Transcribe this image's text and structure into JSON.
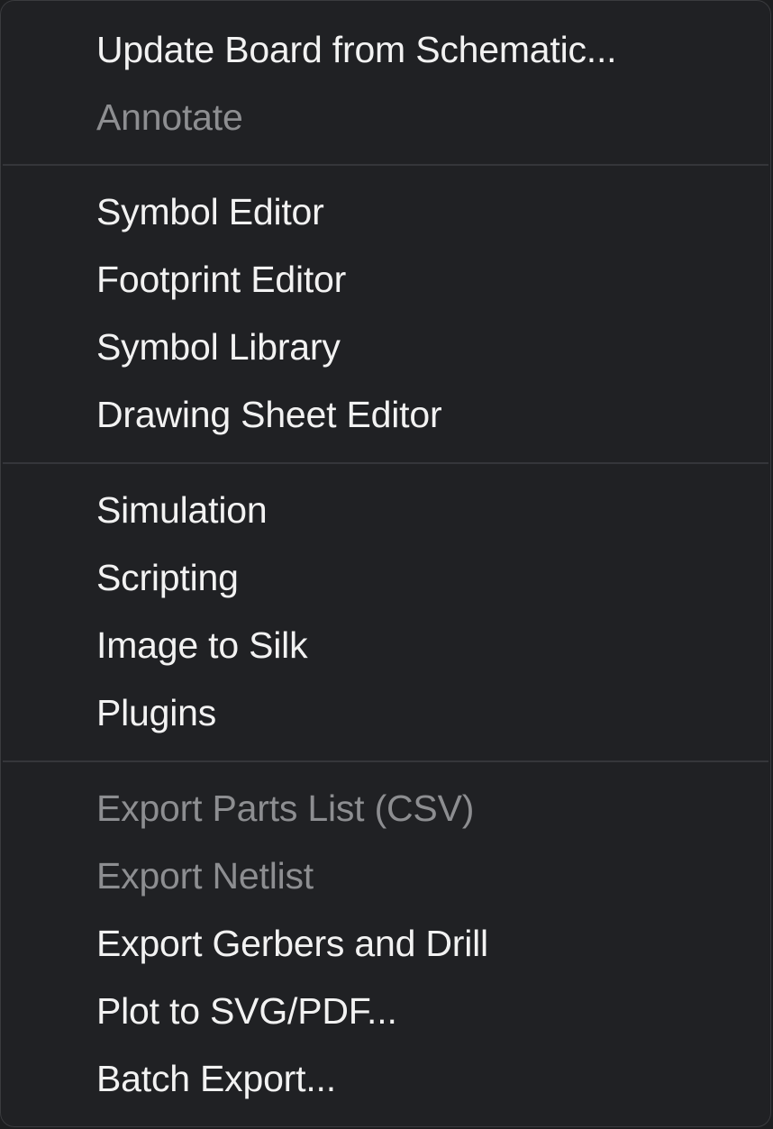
{
  "menu": {
    "groups": [
      {
        "items": [
          {
            "label": "Update Board from Schematic...",
            "enabled": true
          },
          {
            "label": "Annotate",
            "enabled": false
          }
        ]
      },
      {
        "items": [
          {
            "label": "Symbol Editor",
            "enabled": true
          },
          {
            "label": "Footprint Editor",
            "enabled": true
          },
          {
            "label": "Symbol Library",
            "enabled": true
          },
          {
            "label": "Drawing Sheet Editor",
            "enabled": true
          }
        ]
      },
      {
        "items": [
          {
            "label": "Simulation",
            "enabled": true
          },
          {
            "label": "Scripting",
            "enabled": true
          },
          {
            "label": "Image to Silk",
            "enabled": true
          },
          {
            "label": "Plugins",
            "enabled": true
          }
        ]
      },
      {
        "items": [
          {
            "label": "Export Parts List (CSV)",
            "enabled": false
          },
          {
            "label": "Export Netlist",
            "enabled": false
          },
          {
            "label": "Export Gerbers and Drill",
            "enabled": true
          },
          {
            "label": "Plot to SVG/PDF...",
            "enabled": true
          },
          {
            "label": "Batch Export...",
            "enabled": true
          }
        ]
      }
    ],
    "colors": {
      "background": "#202124",
      "text": "#f2f2f2",
      "disabled_text": "#8d8e91",
      "separator": "#35363a"
    }
  }
}
